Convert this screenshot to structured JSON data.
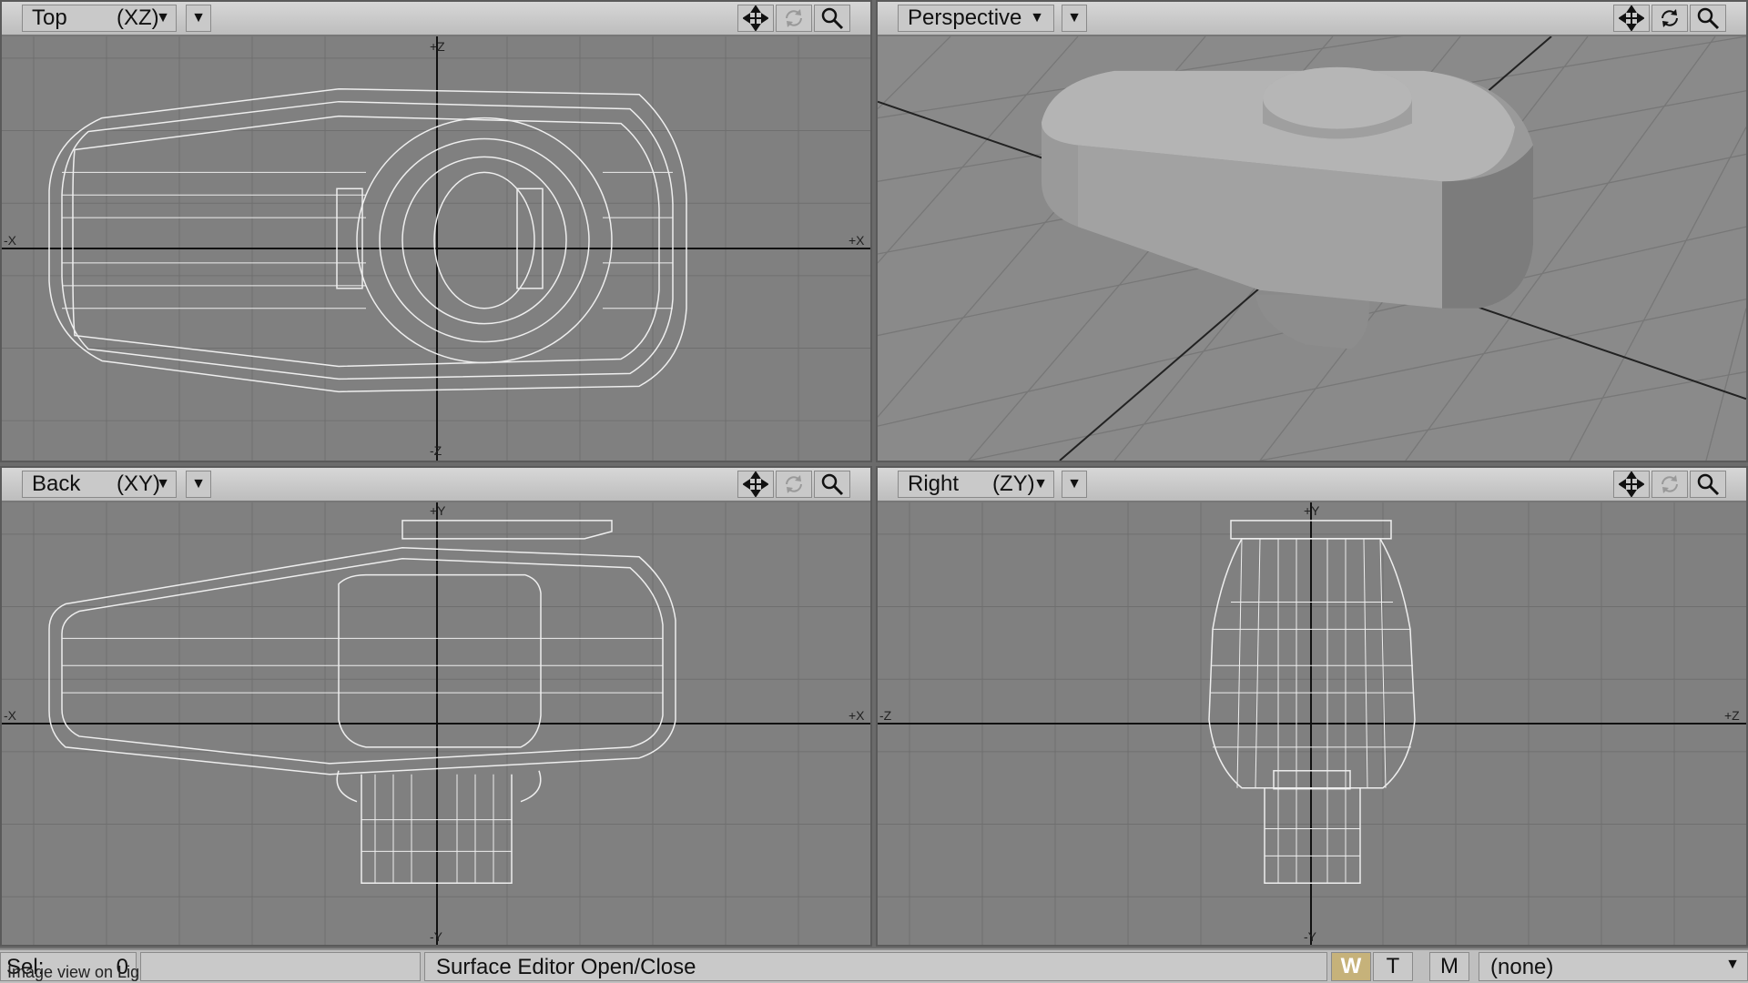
{
  "viewports": [
    {
      "name": "Top",
      "axes": "(XZ)",
      "caret": "▼",
      "dropdown": "▼"
    },
    {
      "name": "Perspective",
      "axes": "",
      "caret": "▼",
      "dropdown": "▼"
    },
    {
      "name": "Back",
      "axes": "(XY)",
      "caret": "▼",
      "dropdown": "▼"
    },
    {
      "name": "Right",
      "axes": "(ZY)",
      "caret": "▼",
      "dropdown": "▼"
    }
  ],
  "axis_labels": {
    "top": {
      "plus_z": "+Z",
      "minus_z": "-Z",
      "minus_x": "-X",
      "plus_x": "+X"
    },
    "back": {
      "plus_y": "+Y",
      "minus_y": "-Y",
      "minus_x": "-X",
      "plus_x": "+X"
    },
    "right": {
      "plus_y": "+Y",
      "minus_y": "-Y",
      "minus_z": "-Z",
      "plus_z": "+Z"
    }
  },
  "statusbar": {
    "sel_label": "Sel:",
    "sel_value": "0",
    "hint": "Image view on Lightwave",
    "message": "Surface Editor Open/Close",
    "mode_w": "W",
    "mode_t": "T",
    "mode_m": "M",
    "surface": "(none)",
    "surface_caret": "▼"
  },
  "icons": {
    "move": "move-icon",
    "rotate": "rotate-icon",
    "zoom": "magnifier-icon"
  },
  "colors": {
    "viewport_bg": "#808080",
    "grid": "#6f6f6f",
    "axis": "#111111",
    "wire": "#f2f2f2",
    "mode_w_active": "#c6b27a"
  }
}
